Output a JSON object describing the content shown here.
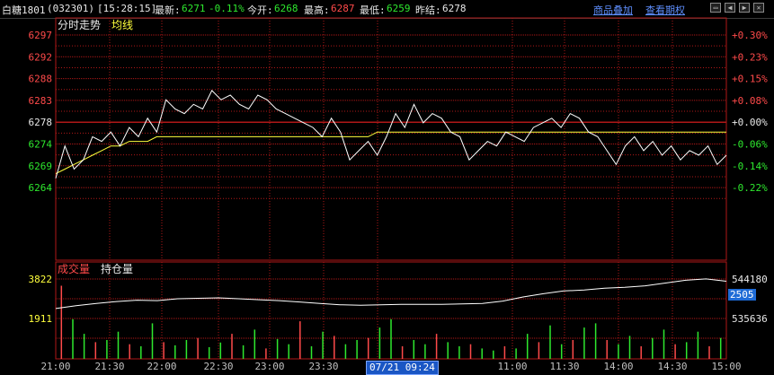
{
  "header": {
    "name": "白糖1801",
    "code": "(032301)",
    "time": "[15:28:15]",
    "latest_label": "最新:",
    "latest": "6271",
    "change": "-0.11%",
    "open_label": "今开:",
    "open": "6268",
    "high_label": "最高:",
    "high": "6287",
    "low_label": "最低:",
    "low": "6259",
    "prev_label": "昨结:",
    "prev": "6278",
    "link_overlay": "商品叠加",
    "link_history": "查看期权"
  },
  "price_panel": {
    "label_trend": "分时走势",
    "label_avg": "均线",
    "left_ticks": [
      {
        "v": "6297",
        "c": "#ff4a4a"
      },
      {
        "v": "6292",
        "c": "#ff4a4a"
      },
      {
        "v": "6288",
        "c": "#ff4a4a"
      },
      {
        "v": "6283",
        "c": "#ff4a4a"
      },
      {
        "v": "6278",
        "c": "#e8e8e8"
      },
      {
        "v": "6274",
        "c": "#2ee82e"
      },
      {
        "v": "6269",
        "c": "#2ee82e"
      },
      {
        "v": "6264",
        "c": "#2ee82e"
      }
    ],
    "right_ticks": [
      {
        "v": "+0.30%",
        "c": "#ff4a4a"
      },
      {
        "v": "+0.23%",
        "c": "#ff4a4a"
      },
      {
        "v": "+0.15%",
        "c": "#ff4a4a"
      },
      {
        "v": "+0.08%",
        "c": "#ff4a4a"
      },
      {
        "v": "+0.00%",
        "c": "#e8e8e8"
      },
      {
        "v": "-0.06%",
        "c": "#2ee82e"
      },
      {
        "v": "-0.14%",
        "c": "#2ee82e"
      },
      {
        "v": "-0.22%",
        "c": "#2ee82e"
      }
    ]
  },
  "volume_panel": {
    "label_vol": "成交量",
    "label_oi": "持仓量",
    "left_ticks": [
      "3822",
      "1911"
    ],
    "right_top": "544180",
    "right_tag": "2505",
    "right_bottom": "535636"
  },
  "time_axis": [
    "21:00",
    "21:30",
    "22:00",
    "22:30",
    "23:00",
    "23:30",
    "",
    "11:00",
    "11:30",
    "14:00",
    "14:30",
    "15:00"
  ],
  "cursor_tip": "07/21 09:24",
  "colors": {
    "up": "#ff4a4a",
    "down": "#2ee82e",
    "grid": "#b01818",
    "price": "#ffffff",
    "avg": "#ffff3c"
  },
  "chart_data": {
    "type": "line",
    "ylim": [
      6264,
      6297
    ],
    "price": [
      6266,
      6273,
      6268,
      6270,
      6275,
      6274,
      6276,
      6273,
      6277,
      6275,
      6279,
      6276,
      6283,
      6281,
      6280,
      6282,
      6281,
      6285,
      6283,
      6284,
      6282,
      6281,
      6284,
      6283,
      6281,
      6280,
      6279,
      6278,
      6277,
      6275,
      6279,
      6276,
      6270,
      6272,
      6274,
      6271,
      6275,
      6280,
      6277,
      6282,
      6278,
      6280,
      6279,
      6276,
      6275,
      6270,
      6272,
      6274,
      6273,
      6276,
      6275,
      6274,
      6277,
      6278,
      6279,
      6277,
      6280,
      6279,
      6276,
      6275,
      6272,
      6269,
      6273,
      6275,
      6272,
      6274,
      6271,
      6273,
      6270,
      6272,
      6271,
      6273,
      6269,
      6271
    ],
    "avg": [
      6267,
      6268,
      6269,
      6270,
      6271,
      6272,
      6273,
      6273,
      6274,
      6274,
      6274,
      6275,
      6275,
      6275,
      6275,
      6275,
      6275,
      6275,
      6275,
      6275,
      6275,
      6275,
      6275,
      6275,
      6275,
      6275,
      6275,
      6275,
      6275,
      6275,
      6275,
      6275,
      6275,
      6275,
      6275,
      6276,
      6276,
      6276,
      6276,
      6276,
      6276,
      6276,
      6276,
      6276,
      6276,
      6276,
      6276,
      6276,
      6276,
      6276,
      6276,
      6276,
      6276,
      6276,
      6276,
      6276,
      6276,
      6276,
      6276,
      6276,
      6276,
      6276,
      6276,
      6276,
      6276,
      6276,
      6276,
      6276,
      6276,
      6276,
      6276,
      6276,
      6276,
      6276
    ],
    "open_interest": [
      537800,
      538400,
      538900,
      539300,
      539600,
      539500,
      539900,
      540000,
      540100,
      539900,
      539700,
      539500,
      539200,
      538900,
      538600,
      538500,
      538600,
      538700,
      538700,
      538700,
      538800,
      538900,
      539400,
      540300,
      541000,
      541600,
      541800,
      542200,
      542400,
      542700,
      543300,
      543900,
      544200,
      543700
    ],
    "volume": [
      3500,
      1900,
      1200,
      800,
      900,
      1300,
      700,
      600,
      1700,
      800,
      650,
      900,
      1000,
      560,
      780,
      1200,
      650,
      1400,
      500,
      950,
      700,
      1800,
      600,
      1300,
      1100,
      700,
      900,
      1000,
      1500,
      1900,
      600,
      900,
      700,
      1200,
      800,
      600,
      700,
      500,
      400,
      600,
      500,
      1200,
      800,
      1600,
      700,
      900,
      1500,
      1700,
      900,
      700,
      1100,
      600,
      1000,
      1400,
      700,
      800,
      1300,
      600,
      1000
    ]
  }
}
